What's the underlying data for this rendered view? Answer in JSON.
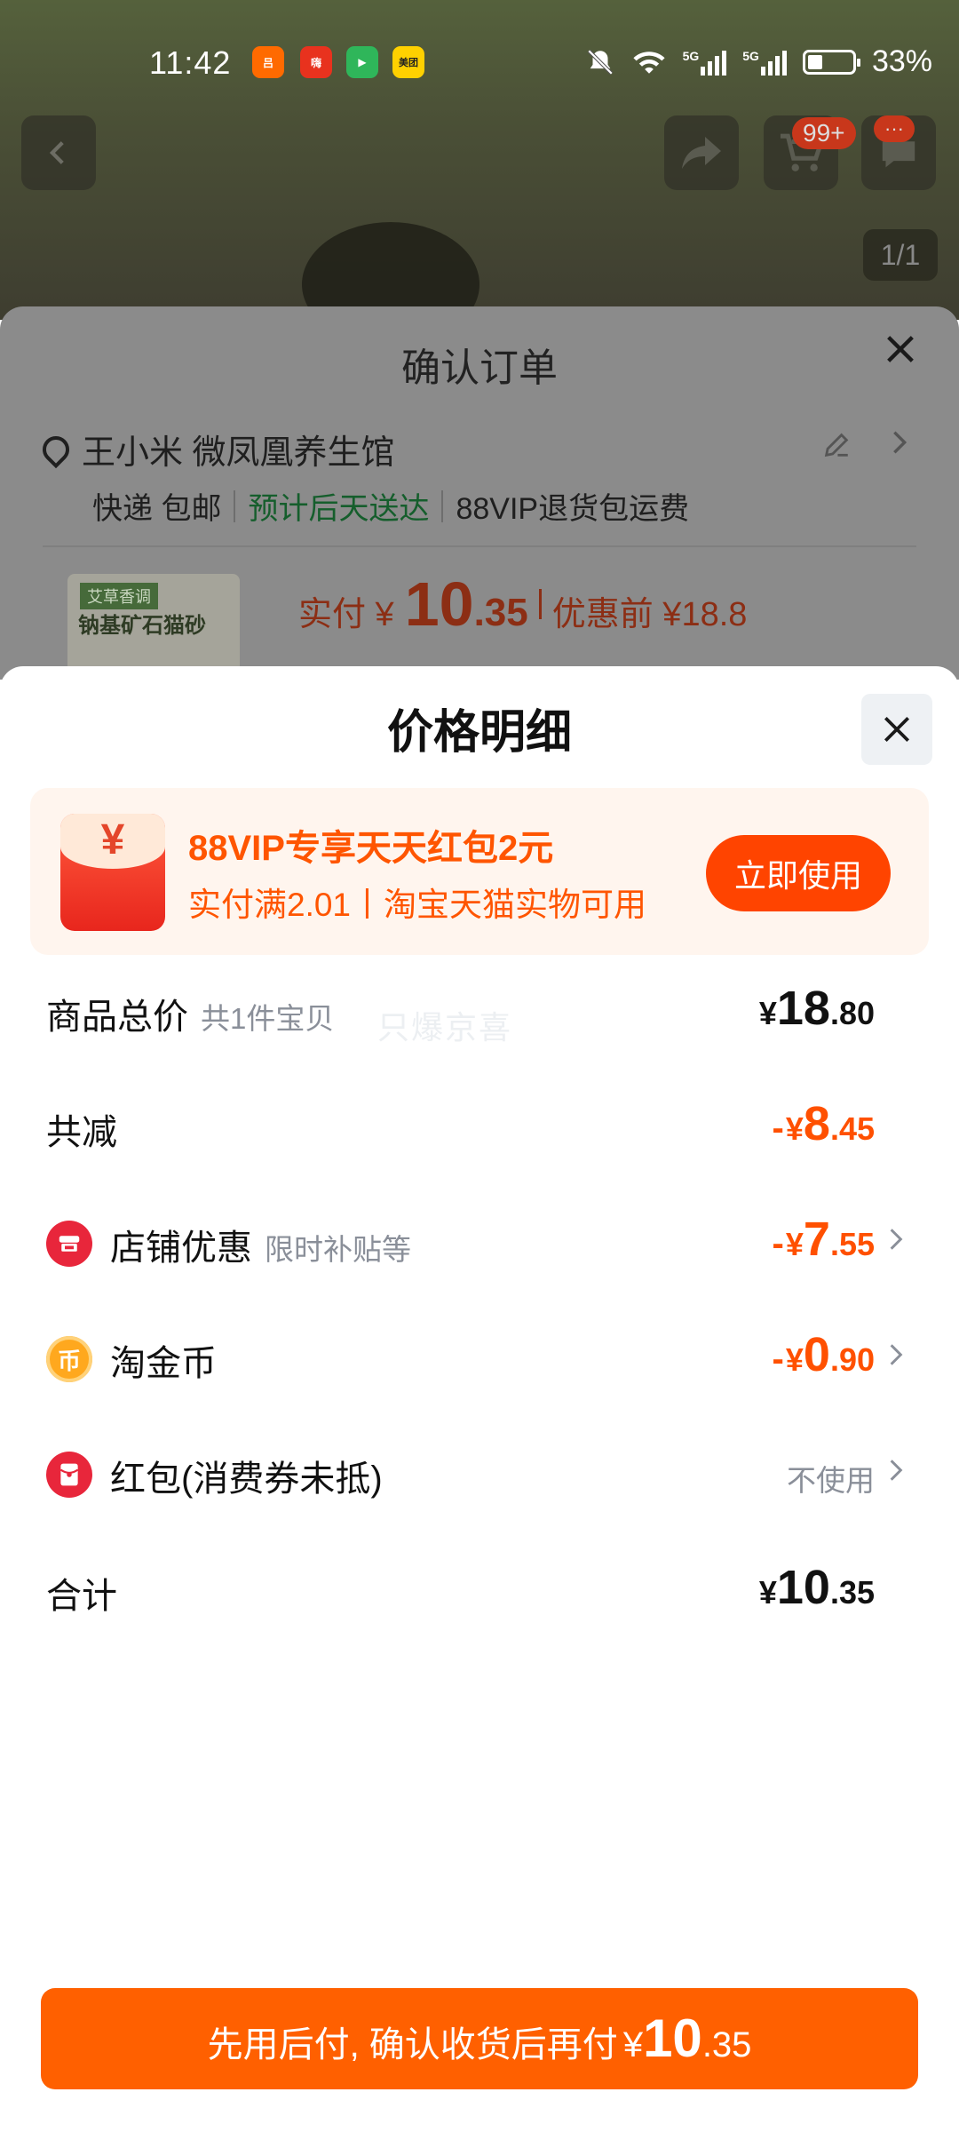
{
  "status_bar": {
    "time": "11:42",
    "apps": [
      {
        "icon": "app-icon-orange",
        "color": "#ff6a00",
        "label": "吕"
      },
      {
        "icon": "app-icon-red",
        "color": "#e8321e",
        "label": "嗨"
      },
      {
        "icon": "app-icon-green",
        "color": "#2fb65a",
        "label": "▶"
      },
      {
        "icon": "meituan-icon",
        "color": "#ffd100",
        "label": "美团"
      }
    ],
    "network_1": "5G",
    "network_2": "5G",
    "battery": "33%"
  },
  "background_page": {
    "cart_badge": "99+",
    "more_badge": "···",
    "pager": "1/1",
    "order_title": "确认订单",
    "recipient": "王小米 微凤凰养生馆",
    "shipping": "快递 包邮",
    "delivery": "预计后天送达",
    "return_note": "88VIP退货包运费",
    "product_tag": "艾草香调",
    "product_name": "钠基矿石猫砂",
    "paid_label": "实付 ¥",
    "paid_int": "10",
    "paid_dec": ".35",
    "pre_discount": "优惠前 ¥18.8"
  },
  "sheet": {
    "title": "价格明细",
    "banner": {
      "title": "88VIP专享天天红包2元",
      "subtitle": "实付满2.01丨淘宝天猫实物可用",
      "button": "立即使用",
      "envelope_symbol": "¥"
    },
    "watermark": "只爆京喜",
    "rows": {
      "total": {
        "label": "商品总价",
        "sub": "共1件宝贝",
        "cur": "¥",
        "int": "18",
        "dec": ".80"
      },
      "reduction": {
        "label": "共减",
        "minus": "-",
        "cur": "¥",
        "int": "8",
        "dec": ".45"
      },
      "store": {
        "label": "店铺优惠",
        "sub": "限时补贴等",
        "minus": "-",
        "cur": "¥",
        "int": "7",
        "dec": ".55",
        "icon": "store-icon",
        "icon_color": "#e8263b"
      },
      "coins": {
        "label": "淘金币",
        "minus": "-",
        "cur": "¥",
        "int": "0",
        "dec": ".90",
        "icon": "coin-icon",
        "icon_color": "#ffa81e",
        "icon_glyph": "币"
      },
      "redpacket": {
        "label": "红包(消费券未抵)",
        "value": "不使用",
        "icon": "red-packet-icon",
        "icon_color": "#e8263b"
      },
      "sum": {
        "label": "合计",
        "cur": "¥",
        "int": "10",
        "dec": ".35"
      }
    },
    "pay_button": {
      "text": "先用后付, 确认收货后再付",
      "cur": "¥",
      "int": "10",
      "dec": ".35"
    }
  },
  "colors": {
    "accent": "#ff5000",
    "button": "#ff6000",
    "banner_bg": "#fff5ee"
  }
}
